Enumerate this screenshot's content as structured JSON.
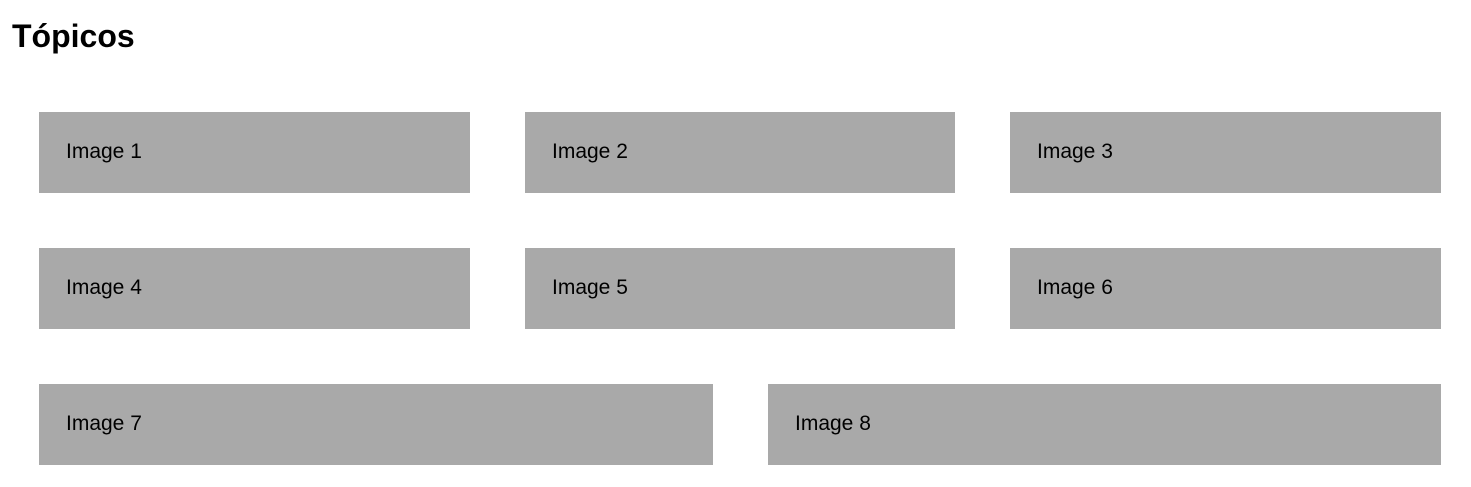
{
  "page": {
    "title": "Tópicos"
  },
  "topics": {
    "row1": [
      {
        "label": "Image 1"
      },
      {
        "label": "Image 2"
      },
      {
        "label": "Image 3"
      }
    ],
    "row2": [
      {
        "label": "Image 4"
      },
      {
        "label": "Image 5"
      },
      {
        "label": "Image 6"
      }
    ],
    "row3": [
      {
        "label": "Image 7"
      },
      {
        "label": "Image 8"
      }
    ]
  },
  "colors": {
    "tile_background": "#a9a9a9",
    "text": "#000000",
    "page_background": "#ffffff"
  }
}
